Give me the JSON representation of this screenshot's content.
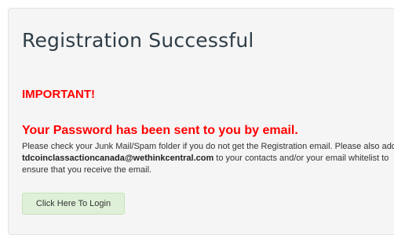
{
  "panel": {
    "title": "Registration Successful",
    "important": "IMPORTANT!",
    "password_sent": "Your Password has been sent to you by email.",
    "message_before_email": "Please check your Junk Mail/Spam folder if you do not get the Registration email. Please also add ",
    "email": "tdcoinclassactioncanada@wethinkcentral.com",
    "message_after_email": " to your contacts and/or your email whitelist to ensure that you receive the email.",
    "login_button_label": "Click Here To Login"
  },
  "colors": {
    "panel_background": "#f5f5f5",
    "panel_border": "#e3e3e3",
    "title_text": "#2f3e48",
    "alert_red": "#ff0000",
    "body_text": "#333333",
    "button_background": "#dff0d8",
    "button_border": "#c6e3b9"
  }
}
